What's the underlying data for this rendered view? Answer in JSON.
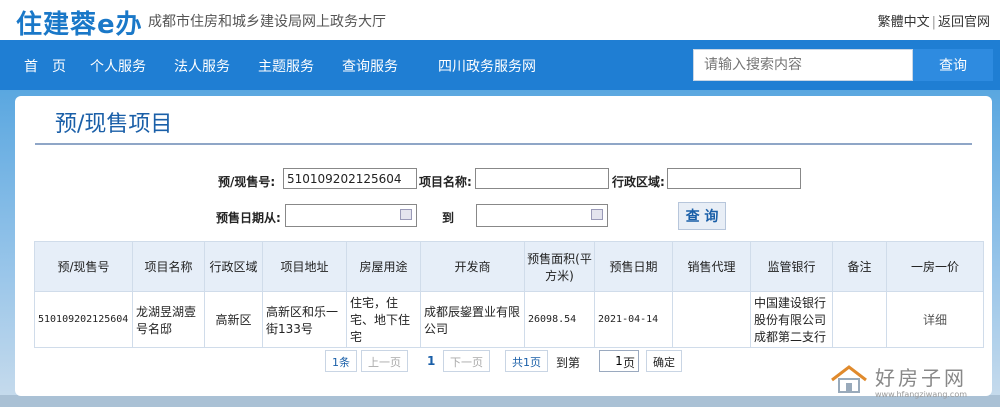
{
  "header": {
    "logo": "住建蓉e办",
    "subtitle": "成都市住房和城乡建设局网上政务大厅",
    "link_traditional": "繁體中文",
    "link_separator": "|",
    "link_home": "返回官网"
  },
  "nav": {
    "items": [
      "首　页",
      "个人服务",
      "法人服务",
      "主题服务",
      "查询服务",
      "四川政务服务网"
    ],
    "search_placeholder": "请输入搜索内容",
    "search_button": "查询"
  },
  "page": {
    "title": "预/现售项目"
  },
  "form": {
    "presale_no_label": "预/现售号:",
    "presale_no_value": "510109202125604",
    "project_name_label": "项目名称:",
    "project_name_value": "",
    "district_label": "行政区域:",
    "district_value": "",
    "date_from_label": "预售日期从:",
    "date_to_label": "到",
    "query_button": "查 询"
  },
  "table": {
    "headers": [
      "预/现售号",
      "项目名称",
      "行政区域",
      "项目地址",
      "房屋用途",
      "开发商",
      "预售面积(平方米)",
      "预售日期",
      "销售代理",
      "监管银行",
      "备注",
      "一房一价"
    ],
    "rows": [
      {
        "presale_no": "510109202125604",
        "project_name": "龙湖昱湖壹号名邸",
        "district": "高新区",
        "address": "高新区和乐一街133号",
        "usage": "住宅，住宅、地下住宅",
        "developer": "成都辰鋆置业有限公司",
        "area": "26098.54",
        "date": "2021-04-14",
        "agent": "",
        "bank": "中国建设银行股份有限公司成都第二支行",
        "remark": "",
        "detail": "详细"
      }
    ]
  },
  "pager": {
    "count": "1条",
    "prev": "上一页",
    "current": "1",
    "next": "下一页",
    "total": "共1页",
    "goto_label": "到第",
    "goto_value": "1",
    "page_unit": "页",
    "confirm": "确定"
  },
  "watermark": {
    "text": "好房子网",
    "url": "www.hfangziwang.com"
  },
  "colors": {
    "brand_blue": "#1f7ed3",
    "title_blue": "#1a5fa8",
    "header_bg": "#e6eef8"
  }
}
